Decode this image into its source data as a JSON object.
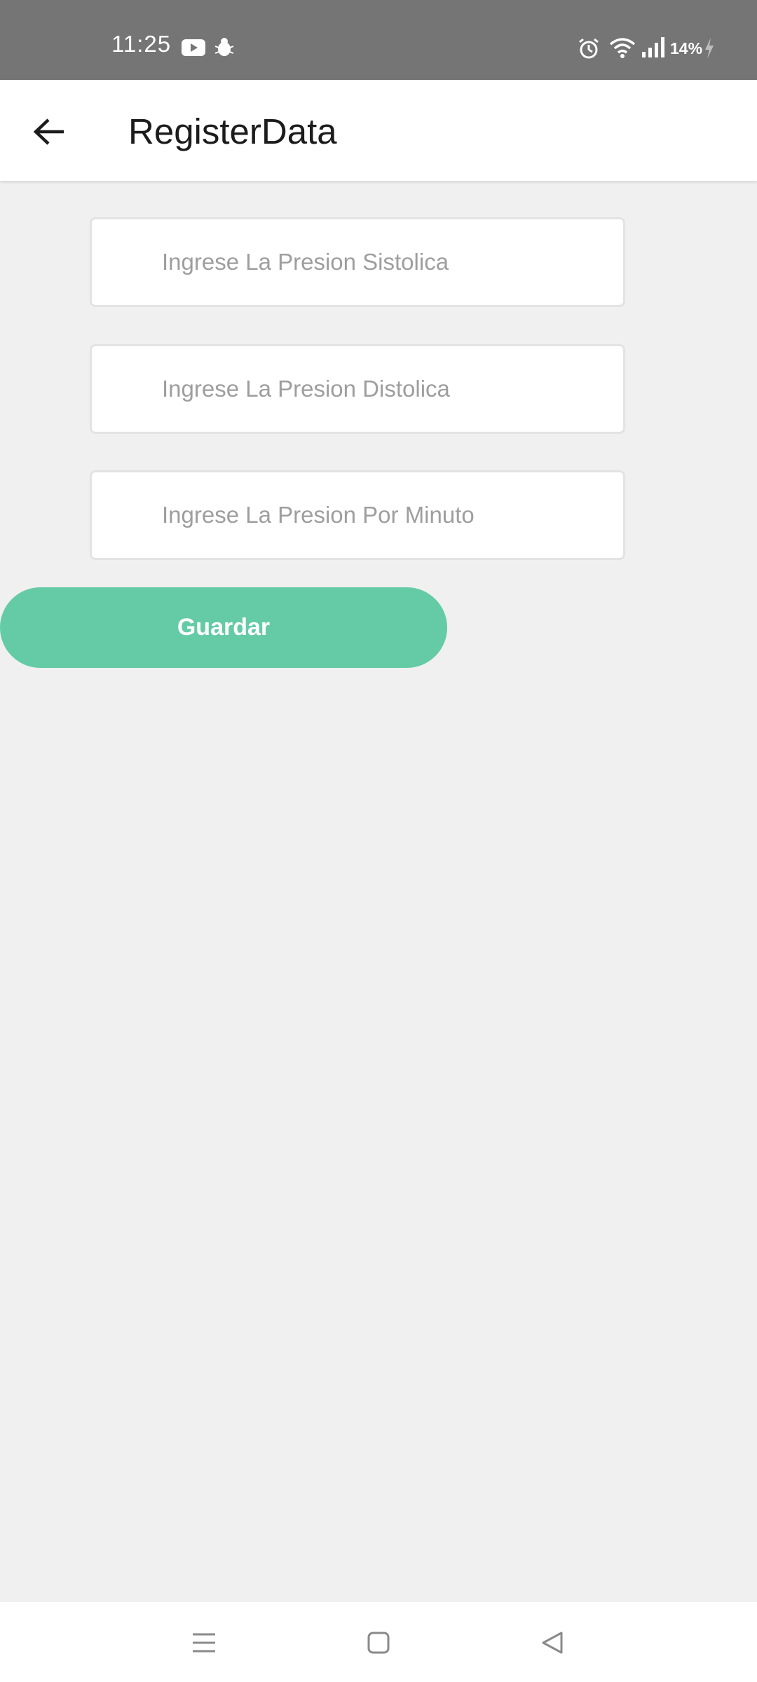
{
  "status_bar": {
    "time": "11:25",
    "battery": "14%",
    "icons": [
      "youtube-icon",
      "bug-icon",
      "alarm-icon",
      "wifi-icon",
      "signal-icon",
      "charging-icon"
    ]
  },
  "app_bar": {
    "title": "RegisterData",
    "back_icon": "arrow-left-icon"
  },
  "form": {
    "systolic": {
      "placeholder": "Ingrese La Presion Sistolica",
      "value": ""
    },
    "diastolic": {
      "placeholder": "Ingrese La Presion Distolica",
      "value": ""
    },
    "per_minute": {
      "placeholder": "Ingrese La Presion Por Minuto",
      "value": ""
    },
    "save_label": "Guardar"
  },
  "nav_bar": {
    "icons": [
      "menu-icon",
      "home-icon",
      "back-triangle-icon"
    ]
  },
  "colors": {
    "status_bar": "#757575",
    "accent": "#64cba6",
    "background": "#f0f0f0",
    "app_bar": "#ffffff"
  }
}
